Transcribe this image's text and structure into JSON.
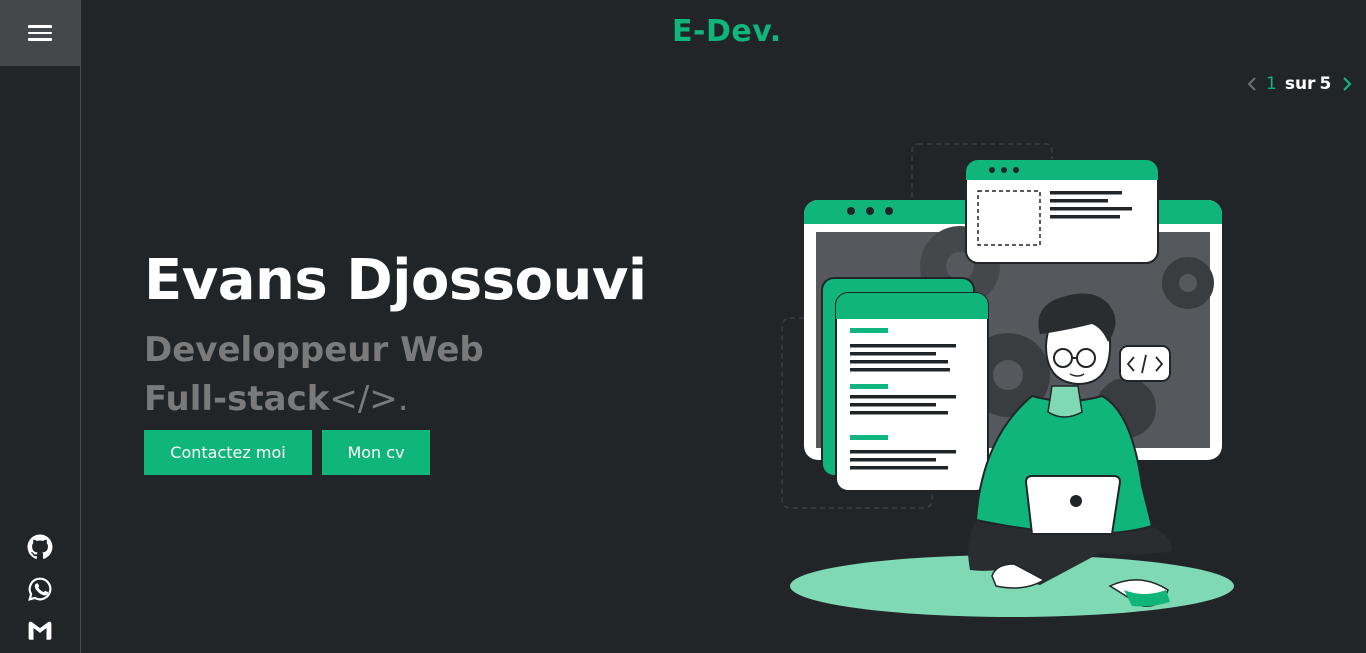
{
  "sidebar": {
    "menu_icon": "hamburger-icon",
    "social": [
      {
        "name": "github-icon"
      },
      {
        "name": "whatsapp-icon"
      },
      {
        "name": "gmail-icon"
      }
    ]
  },
  "header": {
    "logo": "E-Dev."
  },
  "pager": {
    "current": "1",
    "separator": "sur",
    "total": "5"
  },
  "hero": {
    "name": "Evans Djossouvi",
    "role_line1": "Developpeur Web",
    "role_line2": "Full-stack",
    "role_code": "</>.",
    "contact_label": "Contactez moi",
    "cv_label": "Mon cv"
  },
  "colors": {
    "accent": "#10b57b",
    "background": "#222528",
    "sidebar_active": "#45484b",
    "muted_text": "#7a7a7a"
  }
}
